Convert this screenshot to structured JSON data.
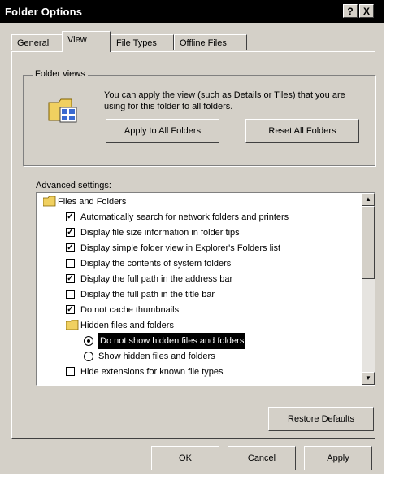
{
  "window": {
    "title": "Folder Options",
    "help_button": "?",
    "close_button": "X"
  },
  "tabs": [
    {
      "label": "General"
    },
    {
      "label": "View"
    },
    {
      "label": "File Types"
    },
    {
      "label": "Offline Files"
    }
  ],
  "folder_views": {
    "group_title": "Folder views",
    "description": "You can apply the view (such as Details or Tiles) that you are using for this folder to all folders.",
    "apply_button": "Apply to All Folders",
    "reset_button": "Reset All Folders",
    "icon": "folder-views-icon"
  },
  "advanced": {
    "label": "Advanced settings:",
    "items": [
      {
        "kind": "folder",
        "indent": 0,
        "label": "Files and Folders"
      },
      {
        "kind": "checkbox",
        "indent": 1,
        "checked": true,
        "label": "Automatically search for network folders and printers"
      },
      {
        "kind": "checkbox",
        "indent": 1,
        "checked": true,
        "label": "Display file size information in folder tips"
      },
      {
        "kind": "checkbox",
        "indent": 1,
        "checked": true,
        "label": "Display simple folder view in Explorer's Folders list"
      },
      {
        "kind": "checkbox",
        "indent": 1,
        "checked": false,
        "label": "Display the contents of system folders"
      },
      {
        "kind": "checkbox",
        "indent": 1,
        "checked": true,
        "label": "Display the full path in the address bar"
      },
      {
        "kind": "checkbox",
        "indent": 1,
        "checked": false,
        "label": "Display the full path in the title bar"
      },
      {
        "kind": "checkbox",
        "indent": 1,
        "checked": true,
        "label": "Do not cache thumbnails"
      },
      {
        "kind": "folder",
        "indent": 1,
        "label": "Hidden files and folders"
      },
      {
        "kind": "radio",
        "indent": 2,
        "checked": true,
        "highlighted": true,
        "label": "Do not show hidden files and folders"
      },
      {
        "kind": "radio",
        "indent": 2,
        "checked": false,
        "label": "Show hidden files and folders"
      },
      {
        "kind": "checkbox",
        "indent": 1,
        "checked": false,
        "label": "Hide extensions for known file types"
      }
    ]
  },
  "restore_defaults_button": "Restore Defaults",
  "footer": {
    "ok": "OK",
    "cancel": "Cancel",
    "apply": "Apply"
  }
}
